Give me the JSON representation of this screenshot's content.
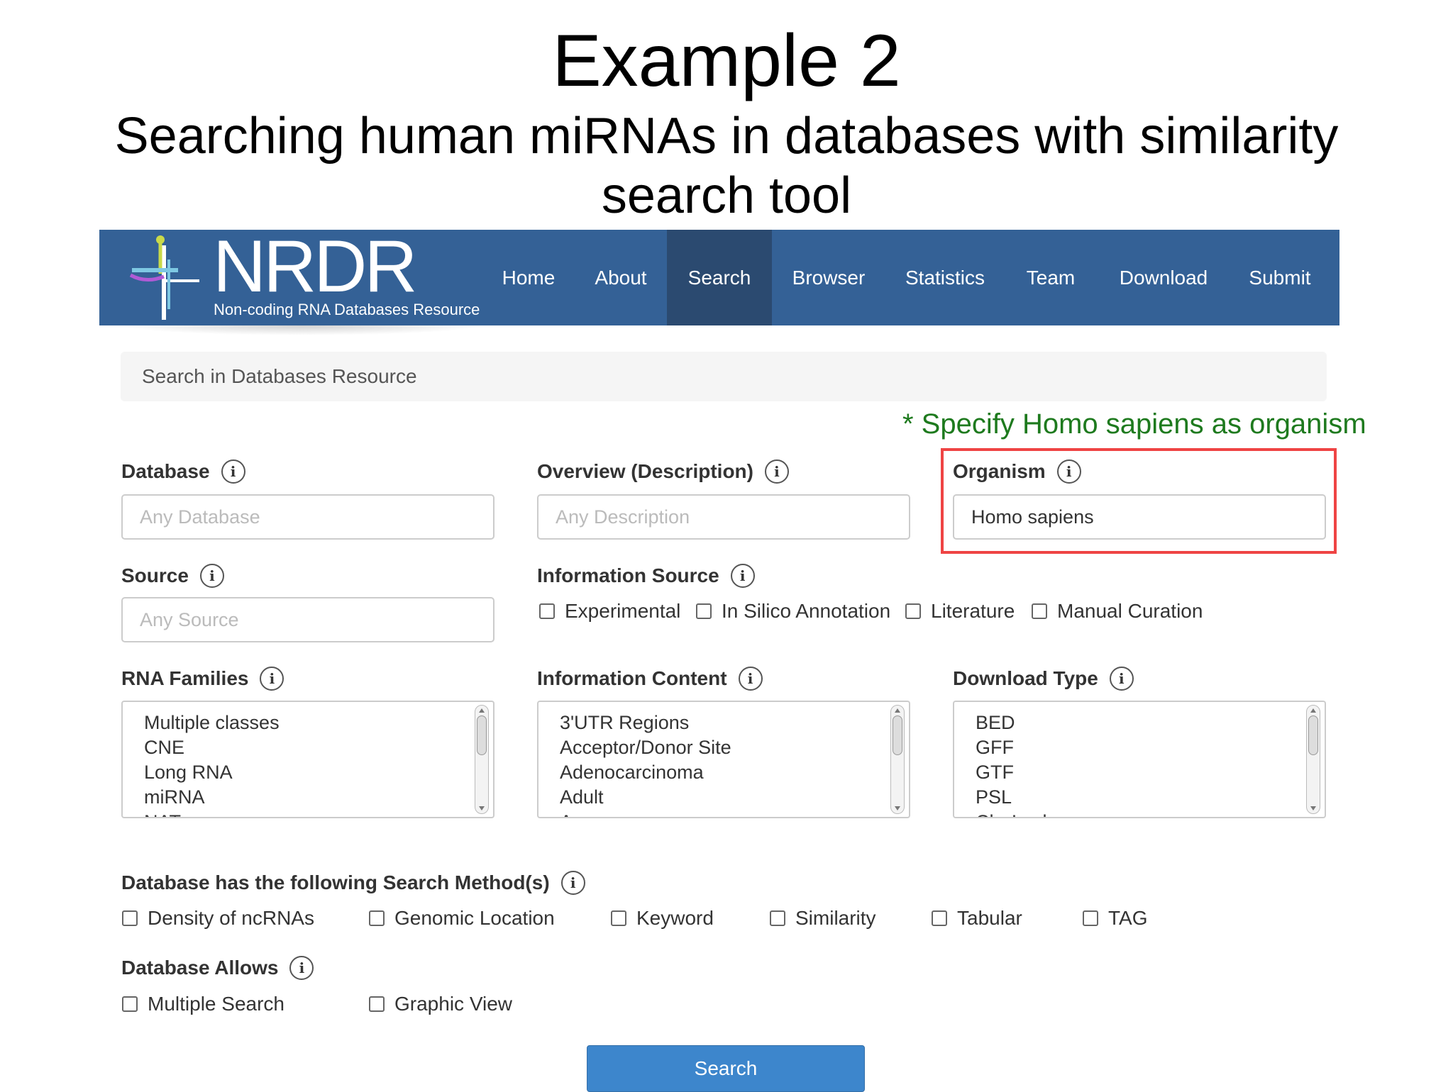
{
  "slide": {
    "title": "Example 2",
    "subtitle": "Searching human miRNAs in databases with similarity search tool"
  },
  "nav": {
    "logo": "NRDR",
    "logo_subtitle": "Non-coding RNA Databases Resource",
    "items": [
      "Home",
      "About",
      "Search",
      "Browser",
      "Statistics",
      "Team",
      "Download",
      "Submit"
    ],
    "active": "Search"
  },
  "search_bar": {
    "placeholder": "Search in Databases Resource"
  },
  "annotation": "* Specify Homo sapiens as organism",
  "fields": {
    "database": {
      "label": "Database",
      "placeholder": "Any Database"
    },
    "overview": {
      "label": "Overview (Description)",
      "placeholder": "Any Description"
    },
    "organism": {
      "label": "Organism",
      "value": "Homo sapiens"
    },
    "source": {
      "label": "Source",
      "placeholder": "Any Source"
    }
  },
  "information_source": {
    "label": "Information Source",
    "options": [
      "Experimental",
      "In Silico Annotation",
      "Literature",
      "Manual Curation"
    ]
  },
  "rna_families": {
    "label": "RNA Families",
    "options": [
      "Multiple classes",
      "CNE",
      "Long RNA",
      "miRNA",
      "NAT"
    ]
  },
  "information_content": {
    "label": "Information Content",
    "options": [
      "3'UTR Regions",
      "Acceptor/Donor Site",
      "Adenocarcinoma",
      "Adult",
      "A"
    ]
  },
  "download_type": {
    "label": "Download Type",
    "options": [
      "BED",
      "GFF",
      "GTF",
      "PSL",
      "Chr Lock"
    ]
  },
  "search_methods": {
    "label": "Database has the following Search Method(s)",
    "options": [
      "Density of ncRNAs",
      "Genomic Location",
      "Keyword",
      "Similarity",
      "Tabular",
      "TAG"
    ]
  },
  "database_allows": {
    "label": "Database Allows",
    "options": [
      "Multiple Search",
      "Graphic View"
    ]
  },
  "search_button": "Search",
  "colors": {
    "navbar": "#346196",
    "nav_active": "#2b4a70",
    "button": "#3d86cc",
    "highlight": "#ef4444",
    "note": "#1e7a1e"
  }
}
